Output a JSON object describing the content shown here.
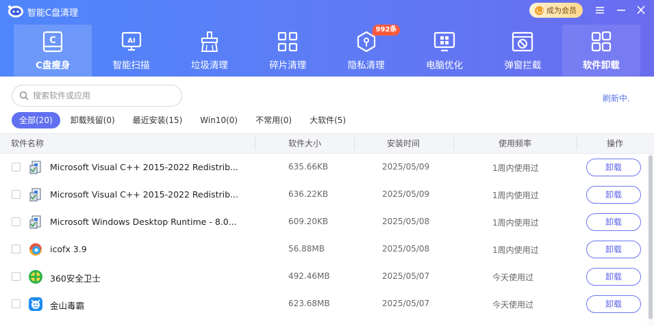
{
  "app": {
    "title": "智能C盘清理",
    "vip_label": "成为会员"
  },
  "nav": [
    {
      "label": "C盘瘦身",
      "icon": "c-drive-icon",
      "active": true
    },
    {
      "label": "智能扫描",
      "icon": "ai-scan-icon"
    },
    {
      "label": "垃圾清理",
      "icon": "broom-icon"
    },
    {
      "label": "碎片清理",
      "icon": "grid-icon"
    },
    {
      "label": "隐私清理",
      "icon": "privacy-icon",
      "badge": "992条"
    },
    {
      "label": "电脑优化",
      "icon": "windows-icon"
    },
    {
      "label": "弹窗拦截",
      "icon": "popup-block-icon"
    },
    {
      "label": "软件卸载",
      "icon": "app-grid-icon",
      "bold": true
    }
  ],
  "search": {
    "placeholder": "搜索软件或应用"
  },
  "refresh_label": "刷新中.",
  "filters": [
    {
      "label": "全部(20)",
      "active": true
    },
    {
      "label": "卸载残留(0)"
    },
    {
      "label": "最近安装(15)"
    },
    {
      "label": "Win10(0)"
    },
    {
      "label": "不常用(0)"
    },
    {
      "label": "大软件(5)"
    }
  ],
  "table": {
    "headers": {
      "name": "软件名称",
      "size": "软件大小",
      "date": "安装时间",
      "freq": "使用频率",
      "action": "操作"
    },
    "action_label": "卸载",
    "rows": [
      {
        "name": "Microsoft Visual C++ 2015-2022 Redistrib...",
        "size": "635.66KB",
        "date": "2025/05/09",
        "freq": "1周内使用过",
        "icon": "installer-icon"
      },
      {
        "name": "Microsoft Visual C++ 2015-2022 Redistrib...",
        "size": "636.22KB",
        "date": "2025/05/09",
        "freq": "1周内使用过",
        "icon": "installer-icon"
      },
      {
        "name": "Microsoft Windows Desktop Runtime - 8.0...",
        "size": "609.20KB",
        "date": "2025/05/08",
        "freq": "1周内使用过",
        "icon": "installer-icon"
      },
      {
        "name": "icofx 3.9",
        "size": "56.88MB",
        "date": "2025/05/08",
        "freq": "1周内使用过",
        "icon": "icofx-icon"
      },
      {
        "name": "360安全卫士",
        "size": "492.46MB",
        "date": "2025/05/07",
        "freq": "今天使用过",
        "icon": "360-icon"
      },
      {
        "name": "金山毒霸",
        "size": "623.68MB",
        "date": "2025/05/07",
        "freq": "今天使用过",
        "icon": "duba-icon"
      }
    ]
  },
  "colors": {
    "accent": "#6070f0",
    "header_gradient_start": "#4f86fb",
    "header_gradient_end": "#6a6cf0",
    "badge": "#ff5a3c"
  }
}
